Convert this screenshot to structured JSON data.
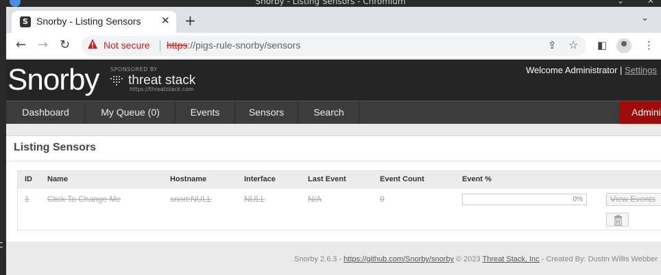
{
  "os": {
    "window_title": "Snorby - Listing Sensors - Chromium",
    "left_edge_glyphs": [
      "I",
      "c"
    ]
  },
  "browser": {
    "tab": {
      "title": "Snorby - Listing Sensors",
      "favicon_letter": "S",
      "close": "✕"
    },
    "new_tab": "+",
    "tab_menu": "⌄",
    "nav": {
      "back": "←",
      "forward": "→",
      "reload": "↻"
    },
    "omnibox": {
      "security_label": "Not secure",
      "url_scheme": "https",
      "url_rest": "://pigs-rule-snorby/sensors"
    },
    "toolbar_icons": {
      "share": "⇪",
      "star": "☆",
      "sidebar": "◧",
      "menu": "⋮"
    }
  },
  "header": {
    "logo": "Snorby",
    "sponsored": "SPONSORED BY",
    "sponsor_name": "threat stack",
    "sponsor_url": "https://threatstack.com",
    "welcome": "Welcome Administrator",
    "separator": " | ",
    "settings": "Settings"
  },
  "nav": {
    "items": [
      {
        "label": "Dashboard"
      },
      {
        "label": "My Queue (0)"
      },
      {
        "label": "Events"
      },
      {
        "label": "Sensors"
      },
      {
        "label": "Search"
      }
    ],
    "admin": "Administration"
  },
  "panel": {
    "title": "Listing Sensors",
    "columns": [
      "ID",
      "Name",
      "Hostname",
      "Interface",
      "Last Event",
      "Event Count",
      "Event %"
    ],
    "rows": [
      {
        "id": "1",
        "name": "Click To Change Me",
        "hostname": "snort:NULL",
        "interface": "NULL",
        "last_event": "N/A",
        "event_count": "0",
        "event_percent": 0,
        "event_percent_label": "0%",
        "view_events": "View Events"
      }
    ]
  },
  "footer": {
    "prefix": "Snorby 2.6.3 - ",
    "github": "https://github.com/Snorby/snorby",
    "copyright": " © 2023 ",
    "company": "Threat Stack, Inc",
    "created": " - Created By: Dustin Willis Webber"
  },
  "colors": {
    "header_bg": "#252525",
    "nav_bg": "#3c3c3c",
    "admin_bg": "#9e0b0b",
    "not_secure": "#c5221f"
  }
}
